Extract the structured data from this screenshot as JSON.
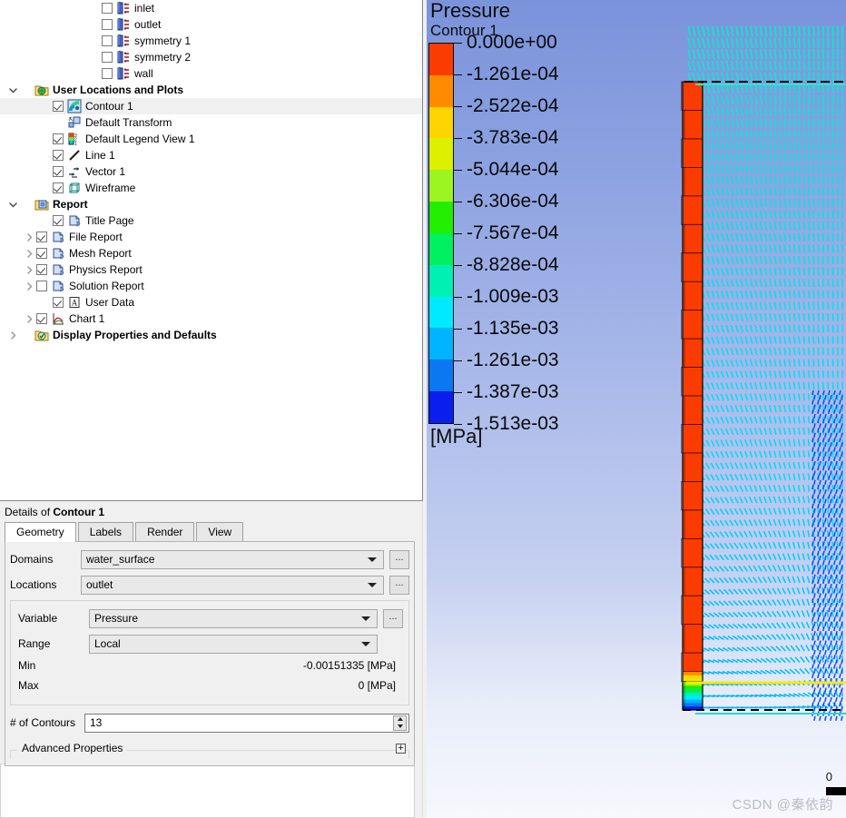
{
  "tree": {
    "items": [
      {
        "indent": 5,
        "expander": "none",
        "checkbox": "unchecked",
        "icon": "boundary-icon",
        "label": "inlet",
        "bold": false,
        "selected": false
      },
      {
        "indent": 5,
        "expander": "none",
        "checkbox": "unchecked",
        "icon": "boundary-icon",
        "label": "outlet",
        "bold": false,
        "selected": false
      },
      {
        "indent": 5,
        "expander": "none",
        "checkbox": "unchecked",
        "icon": "boundary-icon",
        "label": "symmetry 1",
        "bold": false,
        "selected": false
      },
      {
        "indent": 5,
        "expander": "none",
        "checkbox": "unchecked",
        "icon": "boundary-icon",
        "label": "symmetry 2",
        "bold": false,
        "selected": false
      },
      {
        "indent": 5,
        "expander": "none",
        "checkbox": "unchecked",
        "icon": "boundary-icon",
        "label": "wall",
        "bold": false,
        "selected": false
      },
      {
        "indent": 0,
        "expander": "down",
        "checkbox": "none",
        "icon": "folder-locations-icon",
        "label": "User Locations and Plots",
        "bold": true,
        "selected": false
      },
      {
        "indent": 2,
        "expander": "none",
        "checkbox": "checked",
        "icon": "contour-icon",
        "label": "Contour 1",
        "bold": false,
        "selected": true
      },
      {
        "indent": 2,
        "expander": "none",
        "checkbox": "none",
        "icon": "transform-icon",
        "label": "Default Transform",
        "bold": false,
        "selected": false
      },
      {
        "indent": 2,
        "expander": "none",
        "checkbox": "checked",
        "icon": "legend-icon",
        "label": "Default Legend View 1",
        "bold": false,
        "selected": false
      },
      {
        "indent": 2,
        "expander": "none",
        "checkbox": "checked",
        "icon": "line-icon",
        "label": "Line 1",
        "bold": false,
        "selected": false
      },
      {
        "indent": 2,
        "expander": "none",
        "checkbox": "checked",
        "icon": "vector-icon",
        "label": "Vector 1",
        "bold": false,
        "selected": false
      },
      {
        "indent": 2,
        "expander": "none",
        "checkbox": "checked",
        "icon": "wireframe-icon",
        "label": "Wireframe",
        "bold": false,
        "selected": false
      },
      {
        "indent": 0,
        "expander": "down",
        "checkbox": "none",
        "icon": "folder-report-icon",
        "label": "Report",
        "bold": true,
        "selected": false
      },
      {
        "indent": 2,
        "expander": "none",
        "checkbox": "checked",
        "icon": "report-page-icon",
        "label": "Title Page",
        "bold": false,
        "selected": false
      },
      {
        "indent": 1,
        "expander": "right",
        "checkbox": "checked",
        "icon": "report-page-icon",
        "label": "File Report",
        "bold": false,
        "selected": false
      },
      {
        "indent": 1,
        "expander": "right",
        "checkbox": "checked",
        "icon": "report-page-icon",
        "label": "Mesh Report",
        "bold": false,
        "selected": false
      },
      {
        "indent": 1,
        "expander": "right",
        "checkbox": "checked",
        "icon": "report-page-icon",
        "label": "Physics Report",
        "bold": false,
        "selected": false
      },
      {
        "indent": 1,
        "expander": "right",
        "checkbox": "unchecked",
        "icon": "report-page-icon",
        "label": "Solution Report",
        "bold": false,
        "selected": false
      },
      {
        "indent": 2,
        "expander": "none",
        "checkbox": "checked",
        "icon": "user-data-icon",
        "label": "User Data",
        "bold": false,
        "selected": false
      },
      {
        "indent": 1,
        "expander": "right",
        "checkbox": "checked",
        "icon": "chart-icon",
        "label": "Chart 1",
        "bold": false,
        "selected": false
      },
      {
        "indent": 0,
        "expander": "right",
        "checkbox": "none",
        "icon": "display-props-icon",
        "label": "Display Properties and Defaults",
        "bold": true,
        "selected": false
      }
    ]
  },
  "details": {
    "title_prefix": "Details of ",
    "title_object": "Contour 1",
    "tabs": [
      {
        "label": "Geometry",
        "active": true
      },
      {
        "label": "Labels",
        "active": false
      },
      {
        "label": "Render",
        "active": false
      },
      {
        "label": "View",
        "active": false
      }
    ],
    "fields": {
      "domains_label": "Domains",
      "domains_value": "water_surface",
      "locations_label": "Locations",
      "locations_value": "outlet",
      "variable_label": "Variable",
      "variable_value": "Pressure",
      "range_label": "Range",
      "range_value": "Local",
      "min_label": "Min",
      "min_value": "-0.00151335 [MPa]",
      "max_label": "Max",
      "max_value": "0 [MPa]",
      "contours_label": "# of Contours",
      "contours_value": "13",
      "advanced_label": "Advanced Properties",
      "ellipsis_button": "..."
    }
  },
  "viewport": {
    "legend": {
      "title": "Pressure",
      "subtitle": "Contour 1",
      "units": "[MPa]",
      "labels": [
        "0.000e+00",
        "-1.261e-04",
        "-2.522e-04",
        "-3.783e-04",
        "-5.044e-04",
        "-6.306e-04",
        "-7.567e-04",
        "-8.828e-04",
        "-1.009e-03",
        "-1.135e-03",
        "-1.261e-03",
        "-1.387e-03",
        "-1.513e-03"
      ],
      "colors": [
        "#fa3c00",
        "#ff8c00",
        "#ffd400",
        "#dcf000",
        "#9cf520",
        "#22ee00",
        "#00f060",
        "#00f0b4",
        "#00eaff",
        "#00b4ff",
        "#0a78f0",
        "#0a1eee"
      ]
    },
    "axis_label": "0",
    "watermark": "CSDN @秦依韵"
  },
  "chart_data": {
    "type": "heatmap",
    "title": "Pressure",
    "subtitle": "Contour 1",
    "units": "MPa",
    "legend_position": "left",
    "n_contours": 13,
    "range_mode": "Local",
    "variable": "Pressure",
    "min": -0.00151335,
    "max": 0,
    "tick_values": [
      0.0,
      -0.0001261,
      -0.0002522,
      -0.0003783,
      -0.0005044,
      -0.0006306,
      -0.0007567,
      -0.0008828,
      -0.001009,
      -0.001135,
      -0.001261,
      -0.001387,
      -0.001513
    ],
    "tick_labels": [
      "0.000e+00",
      "-1.261e-04",
      "-2.522e-04",
      "-3.783e-04",
      "-5.044e-04",
      "-6.306e-04",
      "-7.567e-04",
      "-8.828e-04",
      "-1.009e-03",
      "-1.135e-03",
      "-1.261e-03",
      "-1.387e-03",
      "-1.513e-03"
    ],
    "band_colors": [
      "#fa3c00",
      "#ff8c00",
      "#ffd400",
      "#dcf000",
      "#9cf520",
      "#22ee00",
      "#00f060",
      "#00f0b4",
      "#00eaff",
      "#00b4ff",
      "#0a78f0",
      "#0a1eee"
    ],
    "overlays": [
      "vector field",
      "wireframe outline",
      "line probe"
    ]
  }
}
